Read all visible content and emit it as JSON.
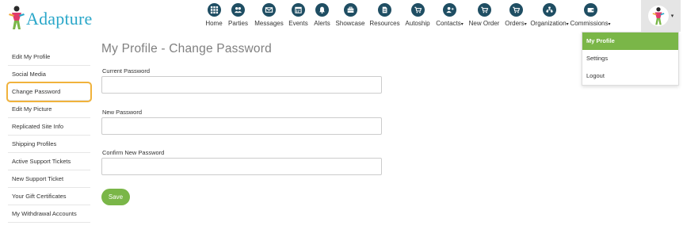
{
  "brand": {
    "name": "Adapture"
  },
  "colors": {
    "accent_green": "#7ab648",
    "nav_icon": "#1f4e63",
    "logo_blue": "#2aa7c9",
    "highlight_outline": "#f0b23c"
  },
  "nav": {
    "items": [
      {
        "label": "Home",
        "icon": "home-grid-icon"
      },
      {
        "label": "Parties",
        "icon": "users-icon"
      },
      {
        "label": "Messages",
        "icon": "envelope-icon"
      },
      {
        "label": "Events",
        "icon": "calendar-icon"
      },
      {
        "label": "Alerts",
        "icon": "bell-icon"
      },
      {
        "label": "Showcase",
        "icon": "briefcase-icon"
      },
      {
        "label": "Resources",
        "icon": "document-icon"
      },
      {
        "label": "Autoship",
        "icon": "cart-icon"
      },
      {
        "label": "Contacts",
        "icon": "user-plus-icon",
        "dropdown": true
      },
      {
        "label": "New Order",
        "icon": "cart-icon"
      },
      {
        "label": "Orders",
        "icon": "cart-icon",
        "dropdown": true
      },
      {
        "label": "Organization",
        "icon": "org-chart-icon",
        "dropdown": true
      },
      {
        "label": "Commissions",
        "icon": "wallet-icon",
        "dropdown": true
      }
    ]
  },
  "profile_menu": {
    "items": [
      {
        "label": "My Profile",
        "active": true
      },
      {
        "label": "Settings",
        "active": false
      },
      {
        "label": "Logout",
        "active": false
      }
    ]
  },
  "sidebar": {
    "items": [
      {
        "label": "Edit My Profile"
      },
      {
        "label": "Social Media"
      },
      {
        "label": "Change Password",
        "highlighted": true
      },
      {
        "label": "Edit My Picture"
      },
      {
        "label": "Replicated Site Info"
      },
      {
        "label": "Shipping Profiles"
      },
      {
        "label": "Active Support Tickets"
      },
      {
        "label": "New Support Ticket"
      },
      {
        "label": "Your Gift Certificates"
      },
      {
        "label": "My Withdrawal Accounts"
      }
    ]
  },
  "main": {
    "title": "My Profile - Change Password",
    "fields": [
      {
        "label": "Current Password",
        "value": "",
        "placeholder": ""
      },
      {
        "label": "New Password",
        "value": "",
        "placeholder": ""
      },
      {
        "label": "Confirm New Password",
        "value": "",
        "placeholder": ""
      }
    ],
    "save_label": "Save"
  }
}
